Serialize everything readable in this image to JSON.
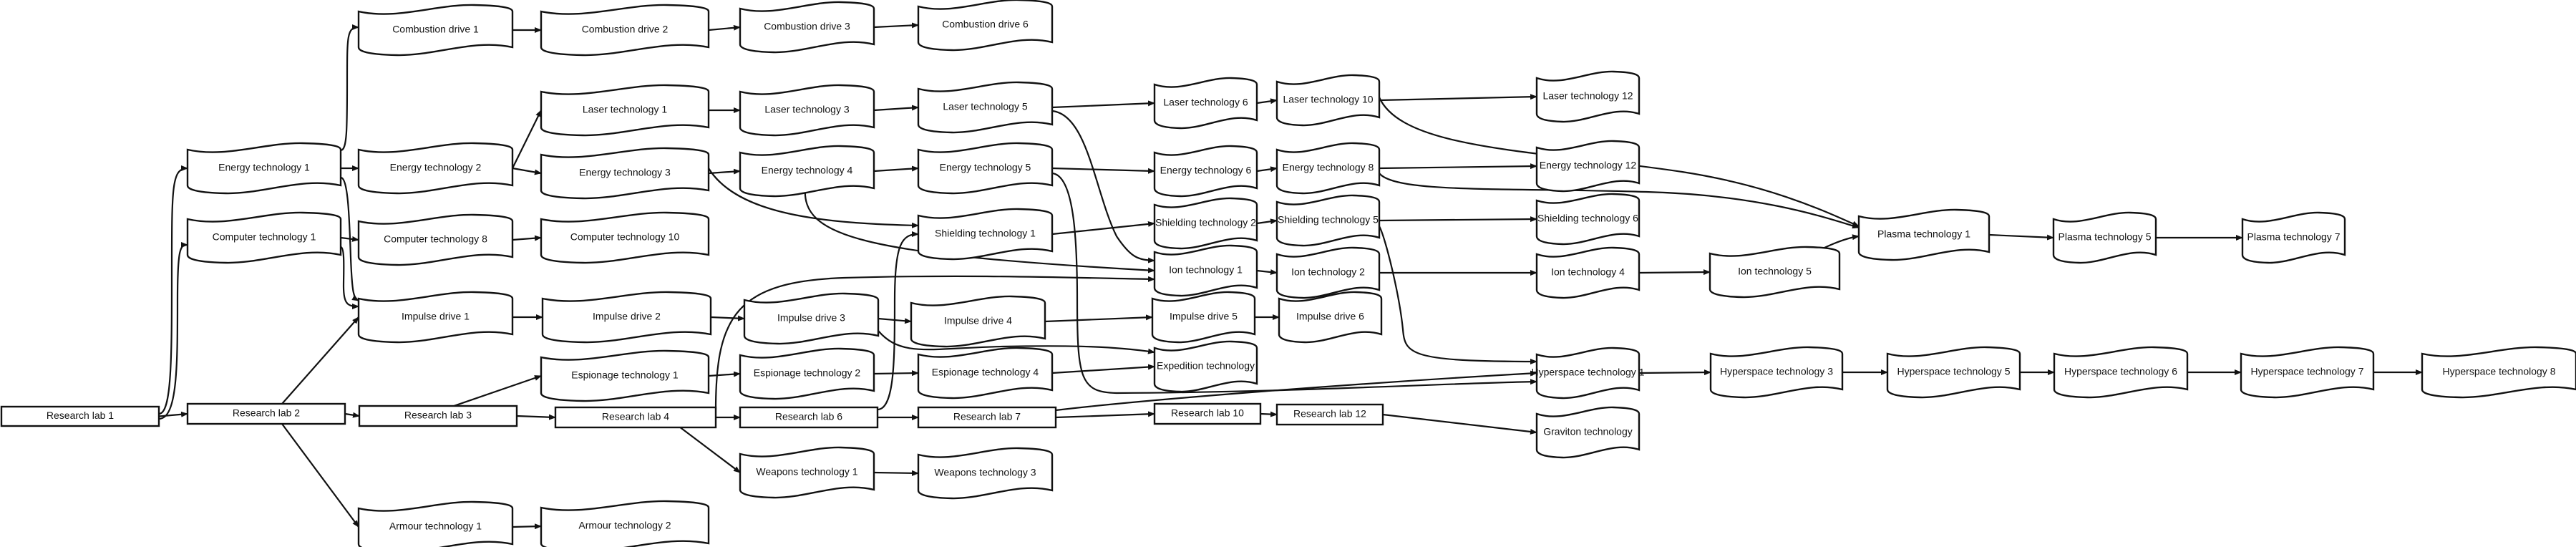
{
  "diagram": {
    "type": "directed-graph",
    "title": "",
    "colors": {
      "stroke": "#111111",
      "fill": "#ffffff",
      "text": "#111111"
    },
    "nodes": [
      {
        "id": "rl1",
        "label": "Research lab 1",
        "shape": "rect"
      },
      {
        "id": "rl2",
        "label": "Research lab 2",
        "shape": "rect"
      },
      {
        "id": "rl3",
        "label": "Research lab 3",
        "shape": "rect"
      },
      {
        "id": "rl4",
        "label": "Research lab 4",
        "shape": "rect"
      },
      {
        "id": "rl6",
        "label": "Research lab 6",
        "shape": "rect"
      },
      {
        "id": "rl7",
        "label": "Research lab 7",
        "shape": "rect"
      },
      {
        "id": "rl10",
        "label": "Research lab 10",
        "shape": "rect"
      },
      {
        "id": "rl12",
        "label": "Research lab 12",
        "shape": "rect"
      },
      {
        "id": "et1",
        "label": "Energy technology 1",
        "shape": "wave"
      },
      {
        "id": "et2",
        "label": "Energy technology 2",
        "shape": "wave"
      },
      {
        "id": "et3",
        "label": "Energy technology 3",
        "shape": "wave"
      },
      {
        "id": "et4",
        "label": "Energy technology 4",
        "shape": "wave"
      },
      {
        "id": "et5",
        "label": "Energy technology 5",
        "shape": "wave"
      },
      {
        "id": "et6",
        "label": "Energy technology 6",
        "shape": "wave"
      },
      {
        "id": "et8",
        "label": "Energy technology 8",
        "shape": "wave"
      },
      {
        "id": "et12",
        "label": "Energy technology 12",
        "shape": "wave"
      },
      {
        "id": "ct1",
        "label": "Computer technology 1",
        "shape": "wave"
      },
      {
        "id": "ct8",
        "label": "Computer technology 8",
        "shape": "wave"
      },
      {
        "id": "ct10",
        "label": "Computer technology 10",
        "shape": "wave"
      },
      {
        "id": "cd1",
        "label": "Combustion drive 1",
        "shape": "wave"
      },
      {
        "id": "cd2",
        "label": "Combustion drive 2",
        "shape": "wave"
      },
      {
        "id": "cd3",
        "label": "Combustion drive 3",
        "shape": "wave"
      },
      {
        "id": "cd6",
        "label": "Combustion drive 6",
        "shape": "wave"
      },
      {
        "id": "lt1",
        "label": "Laser technology 1",
        "shape": "wave"
      },
      {
        "id": "lt3",
        "label": "Laser technology 3",
        "shape": "wave"
      },
      {
        "id": "lt5",
        "label": "Laser technology 5",
        "shape": "wave"
      },
      {
        "id": "lt6",
        "label": "Laser technology 6",
        "shape": "wave"
      },
      {
        "id": "lt10",
        "label": "Laser technology 10",
        "shape": "wave"
      },
      {
        "id": "lt12",
        "label": "Laser technology 12",
        "shape": "wave"
      },
      {
        "id": "id1",
        "label": "Impulse drive 1",
        "shape": "wave"
      },
      {
        "id": "id2",
        "label": "Impulse drive 2",
        "shape": "wave"
      },
      {
        "id": "id3",
        "label": "Impulse drive 3",
        "shape": "wave"
      },
      {
        "id": "id4",
        "label": "Impulse drive 4",
        "shape": "wave"
      },
      {
        "id": "id5",
        "label": "Impulse drive 5",
        "shape": "wave"
      },
      {
        "id": "id6",
        "label": "Impulse drive 6",
        "shape": "wave"
      },
      {
        "id": "es1",
        "label": "Espionage technology 1",
        "shape": "wave"
      },
      {
        "id": "es2",
        "label": "Espionage technology 2",
        "shape": "wave"
      },
      {
        "id": "es4",
        "label": "Espionage technology 4",
        "shape": "wave"
      },
      {
        "id": "at1",
        "label": "Armour technology 1",
        "shape": "wave"
      },
      {
        "id": "at2",
        "label": "Armour technology 2",
        "shape": "wave"
      },
      {
        "id": "wt1",
        "label": "Weapons technology 1",
        "shape": "wave"
      },
      {
        "id": "wt3",
        "label": "Weapons technology 3",
        "shape": "wave"
      },
      {
        "id": "st1",
        "label": "Shielding technology 1",
        "shape": "wave"
      },
      {
        "id": "st2",
        "label": "Shielding technology 2",
        "shape": "wave"
      },
      {
        "id": "st5",
        "label": "Shielding technology 5",
        "shape": "wave"
      },
      {
        "id": "st6",
        "label": "Shielding technology 6",
        "shape": "wave"
      },
      {
        "id": "it1",
        "label": "Ion technology 1",
        "shape": "wave"
      },
      {
        "id": "it2",
        "label": "Ion technology 2",
        "shape": "wave"
      },
      {
        "id": "it4",
        "label": "Ion technology 4",
        "shape": "wave"
      },
      {
        "id": "it5",
        "label": "Ion technology 5",
        "shape": "wave"
      },
      {
        "id": "ex",
        "label": "Expedition technology",
        "shape": "wave"
      },
      {
        "id": "hs1",
        "label": "Hyperspace technology 1",
        "shape": "wave"
      },
      {
        "id": "hs3",
        "label": "Hyperspace technology 3",
        "shape": "wave"
      },
      {
        "id": "hs5",
        "label": "Hyperspace technology 5",
        "shape": "wave"
      },
      {
        "id": "hs6",
        "label": "Hyperspace technology 6",
        "shape": "wave"
      },
      {
        "id": "hs7",
        "label": "Hyperspace technology 7",
        "shape": "wave"
      },
      {
        "id": "hs8",
        "label": "Hyperspace technology 8",
        "shape": "wave"
      },
      {
        "id": "gt",
        "label": "Graviton technology",
        "shape": "wave"
      },
      {
        "id": "pt1",
        "label": "Plasma technology 1",
        "shape": "wave"
      },
      {
        "id": "pt5",
        "label": "Plasma technology 5",
        "shape": "wave"
      },
      {
        "id": "pt7",
        "label": "Plasma technology 7",
        "shape": "wave"
      }
    ],
    "edges": [
      {
        "from": "rl1",
        "to": "rl2"
      },
      {
        "from": "rl1",
        "to": "et1"
      },
      {
        "from": "rl1",
        "to": "ct1"
      },
      {
        "from": "et1",
        "to": "cd1"
      },
      {
        "from": "et1",
        "to": "et2"
      },
      {
        "from": "et1",
        "to": "id1"
      },
      {
        "from": "ct1",
        "to": "ct8"
      },
      {
        "from": "ct1",
        "to": "id1"
      },
      {
        "from": "rl2",
        "to": "id1"
      },
      {
        "from": "rl2",
        "to": "rl3"
      },
      {
        "from": "rl2",
        "to": "at1"
      },
      {
        "from": "cd1",
        "to": "cd2"
      },
      {
        "from": "cd2",
        "to": "cd3"
      },
      {
        "from": "cd3",
        "to": "cd6"
      },
      {
        "from": "et2",
        "to": "lt1"
      },
      {
        "from": "et2",
        "to": "et3"
      },
      {
        "from": "ct8",
        "to": "ct10"
      },
      {
        "from": "id1",
        "to": "id2"
      },
      {
        "from": "rl3",
        "to": "es1"
      },
      {
        "from": "rl3",
        "to": "rl4"
      },
      {
        "from": "at1",
        "to": "at2"
      },
      {
        "from": "lt1",
        "to": "lt3"
      },
      {
        "from": "et3",
        "to": "et4"
      },
      {
        "from": "et3",
        "to": "st1"
      },
      {
        "from": "id2",
        "to": "id3"
      },
      {
        "from": "es1",
        "to": "es2"
      },
      {
        "from": "rl4",
        "to": "rl6"
      },
      {
        "from": "rl4",
        "to": "wt1"
      },
      {
        "from": "rl4",
        "to": "it1"
      },
      {
        "from": "lt3",
        "to": "lt5"
      },
      {
        "from": "et4",
        "to": "et5"
      },
      {
        "from": "et4",
        "to": "it1"
      },
      {
        "from": "id3",
        "to": "id4"
      },
      {
        "from": "id3",
        "to": "ex"
      },
      {
        "from": "es2",
        "to": "es4"
      },
      {
        "from": "rl6",
        "to": "rl7"
      },
      {
        "from": "rl6",
        "to": "st1"
      },
      {
        "from": "wt1",
        "to": "wt3"
      },
      {
        "from": "lt5",
        "to": "lt6"
      },
      {
        "from": "lt5",
        "to": "it1"
      },
      {
        "from": "et5",
        "to": "et6"
      },
      {
        "from": "et5",
        "to": "hs1"
      },
      {
        "from": "st1",
        "to": "st2"
      },
      {
        "from": "id4",
        "to": "id5"
      },
      {
        "from": "es4",
        "to": "ex"
      },
      {
        "from": "rl7",
        "to": "rl10"
      },
      {
        "from": "rl7",
        "to": "hs1"
      },
      {
        "from": "lt6",
        "to": "lt10"
      },
      {
        "from": "et6",
        "to": "et8"
      },
      {
        "from": "st2",
        "to": "st5"
      },
      {
        "from": "it1",
        "to": "it2"
      },
      {
        "from": "id5",
        "to": "id6"
      },
      {
        "from": "rl10",
        "to": "rl12"
      },
      {
        "from": "lt10",
        "to": "lt12"
      },
      {
        "from": "lt10",
        "to": "pt1"
      },
      {
        "from": "et8",
        "to": "et12"
      },
      {
        "from": "et8",
        "to": "pt1"
      },
      {
        "from": "st5",
        "to": "st6"
      },
      {
        "from": "st5",
        "to": "hs1"
      },
      {
        "from": "it2",
        "to": "it4"
      },
      {
        "from": "rl12",
        "to": "gt"
      },
      {
        "from": "it4",
        "to": "it5"
      },
      {
        "from": "it5",
        "to": "pt1"
      },
      {
        "from": "pt1",
        "to": "pt5"
      },
      {
        "from": "pt5",
        "to": "pt7"
      },
      {
        "from": "hs1",
        "to": "hs3"
      },
      {
        "from": "hs3",
        "to": "hs5"
      },
      {
        "from": "hs5",
        "to": "hs6"
      },
      {
        "from": "hs6",
        "to": "hs7"
      },
      {
        "from": "hs7",
        "to": "hs8"
      }
    ]
  }
}
